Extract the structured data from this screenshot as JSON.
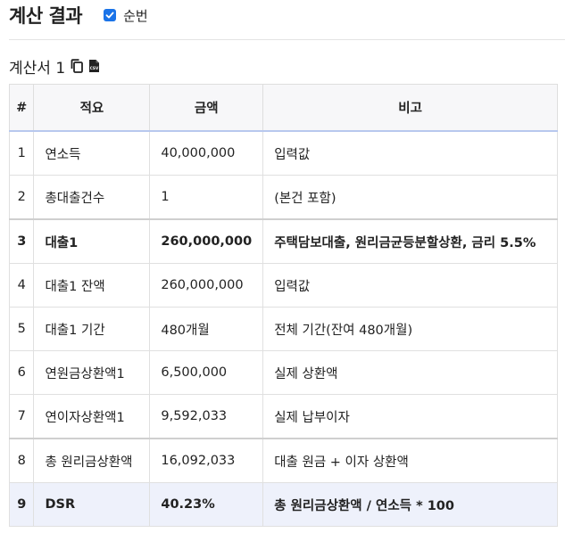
{
  "header": {
    "title": "계산 결과",
    "checkbox_label": "순번",
    "checkbox_checked": true
  },
  "statement": {
    "title": "계산서 1",
    "copy_icon": "copy-icon",
    "csv_icon": "csv-file-icon"
  },
  "table": {
    "columns": [
      "#",
      "적요",
      "금액",
      "비고"
    ],
    "rows": [
      {
        "no": "1",
        "desc": "연소득",
        "amount": "40,000,000",
        "note": "입력값"
      },
      {
        "no": "2",
        "desc": "총대출건수",
        "amount": "1",
        "note": "(본건 포함)"
      },
      {
        "no": "3",
        "desc": "대출1",
        "amount": "260,000,000",
        "note": "주택담보대출, 원리금균등분할상환, 금리 5.5%"
      },
      {
        "no": "4",
        "desc": "대출1 잔액",
        "amount": "260,000,000",
        "note": "입력값"
      },
      {
        "no": "5",
        "desc": "대출1 기간",
        "amount": "480개월",
        "note": "전체 기간(잔여 480개월)"
      },
      {
        "no": "6",
        "desc": "연원금상환액1",
        "amount": "6,500,000",
        "note": "실제 상환액"
      },
      {
        "no": "7",
        "desc": "연이자상환액1",
        "amount": "9,592,033",
        "note": "실제 납부이자"
      },
      {
        "no": "8",
        "desc": "총 원리금상환액",
        "amount": "16,092,033",
        "note": "대출 원금 + 이자 상환액"
      },
      {
        "no": "9",
        "desc": "DSR",
        "amount": "40.23%",
        "note": "총 원리금상환액 / 연소득 * 100"
      }
    ]
  },
  "colors": {
    "accent": "#1a73e8",
    "header_underline": "#b8c8ee",
    "highlight_row": "#eef1fb"
  }
}
